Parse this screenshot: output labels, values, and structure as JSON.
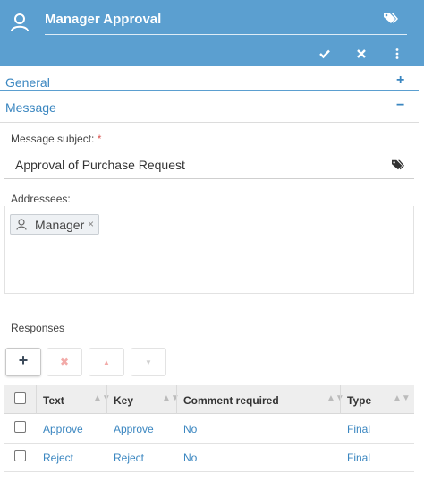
{
  "header": {
    "title": "Manager Approval",
    "icons": [
      "user-icon",
      "tag-icon",
      "check-icon",
      "close-icon",
      "more-vertical-icon"
    ]
  },
  "sections": {
    "general": {
      "label": "General",
      "toggle": "+"
    },
    "message": {
      "label": "Message",
      "toggle": "−"
    }
  },
  "message": {
    "subject_label": "Message subject:",
    "required_mark": "*",
    "subject_value": "Approval of Purchase Request",
    "addressees_label": "Addressees:",
    "addressees": [
      {
        "name": "Manager",
        "remove": "×"
      }
    ]
  },
  "responses": {
    "label": "Responses",
    "toolbar": {
      "add": "+",
      "delete": "✖",
      "up": "▲",
      "down": "▼"
    },
    "columns": [
      "Text",
      "Key",
      "Comment required",
      "Type"
    ],
    "rows": [
      {
        "text": "Approve",
        "key": "Approve",
        "comment_required": "No",
        "type": "Final"
      },
      {
        "text": "Reject",
        "key": "Reject",
        "comment_required": "No",
        "type": "Final"
      }
    ]
  },
  "colors": {
    "header_bg": "#5b9fd0",
    "accent": "#3a86c0",
    "required": "#d9534f"
  }
}
